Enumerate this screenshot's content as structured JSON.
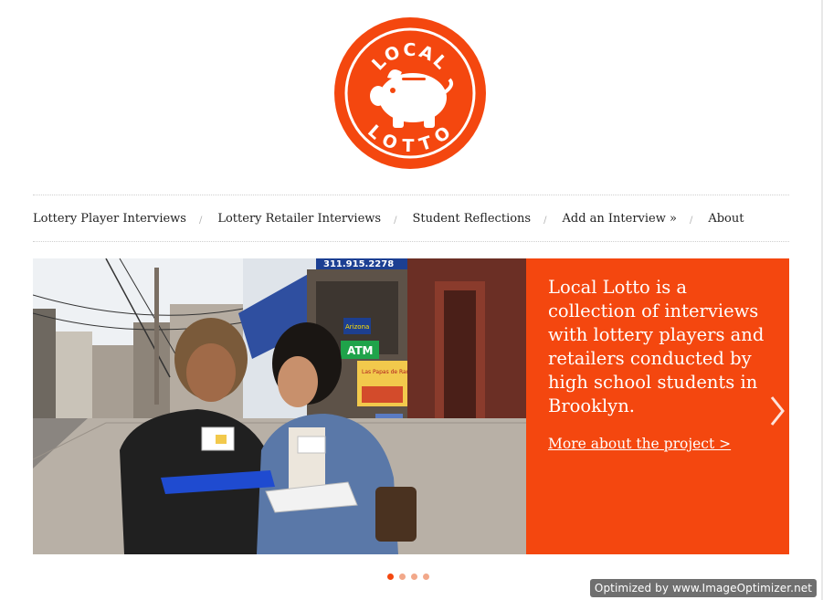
{
  "logo": {
    "line1": "LOCAL",
    "line2": "LOTTO",
    "icon": "piggy-bank-icon",
    "color": "#f4470f"
  },
  "nav": {
    "items": [
      {
        "label": "Lottery Player Interviews"
      },
      {
        "label": "Lottery Retailer Interviews"
      },
      {
        "label": "Student Reflections"
      },
      {
        "label": "Add an Interview »"
      },
      {
        "label": "About"
      }
    ],
    "separator": "/"
  },
  "slider": {
    "photo": {
      "sign_number": "311.915.2278",
      "atm_sign": "ATM",
      "store_sign": "Arizona",
      "poster": "Las Papas de Ramona"
    },
    "panel": {
      "text": "Local Lotto is a collection of interviews with lottery players and retailers conducted by high school students in Brooklyn.",
      "link": "More about the project >",
      "background": "#f4470f"
    },
    "next_icon": "chevron-right-icon",
    "pager": {
      "count": 4,
      "active": 1
    }
  },
  "watermark": "Optimized by www.ImageOptimizer.net"
}
